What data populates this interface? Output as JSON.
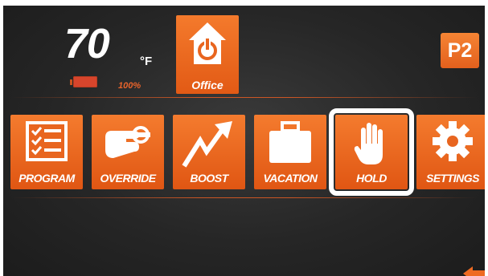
{
  "status": {
    "temperature": "70",
    "unit": "°F",
    "battery_percent": "100%"
  },
  "zone": {
    "label": "Office",
    "icon": "home-power-icon"
  },
  "profile": {
    "label": "P2"
  },
  "menu": {
    "selected": "hold",
    "items": [
      {
        "id": "program",
        "label": "PROGRAM",
        "icon": "checklist-icon"
      },
      {
        "id": "override",
        "label": "OVERRIDE",
        "icon": "pointing-hand-icon"
      },
      {
        "id": "boost",
        "label": "BOOST",
        "icon": "trend-up-arrow-icon"
      },
      {
        "id": "vacation",
        "label": "VACATION",
        "icon": "suitcase-icon"
      },
      {
        "id": "hold",
        "label": "HOLD",
        "icon": "hand-icon"
      },
      {
        "id": "settings",
        "label": "SETTINGS",
        "icon": "gear-icon"
      }
    ]
  },
  "colors": {
    "accent": "#ee6a22",
    "background": "#262626"
  }
}
